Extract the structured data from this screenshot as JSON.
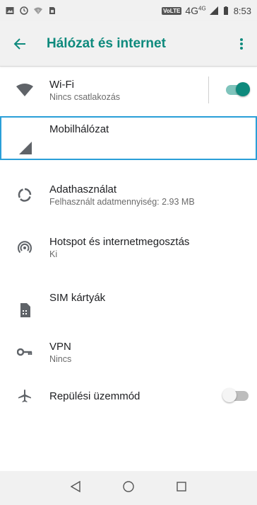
{
  "status_bar": {
    "volte": "VoLTE",
    "network": "4G",
    "network_sup": "4G",
    "time": "8:53"
  },
  "app_bar": {
    "title": "Hálózat és internet"
  },
  "items": [
    {
      "title": "Wi-Fi",
      "subtitle": "Nincs csatlakozás",
      "icon": "wifi-icon",
      "toggle_on": true
    },
    {
      "title": "Mobilhálózat",
      "icon": "signal-icon"
    },
    {
      "title": "Adathasználat",
      "subtitle": "Felhasznált adatmennyiség: 2.93 MB",
      "icon": "data-usage-icon"
    },
    {
      "title": "Hotspot és internetmegosztás",
      "subtitle": "Ki",
      "icon": "hotspot-icon"
    },
    {
      "title": "SIM kártyák",
      "icon": "sim-card-icon"
    },
    {
      "title": "VPN",
      "subtitle": "Nincs",
      "icon": "vpn-key-icon"
    },
    {
      "title": "Repülési üzemmód",
      "icon": "airplane-icon",
      "toggle_on": false
    }
  ],
  "colors": {
    "accent": "#0e8a7d",
    "focus_border": "#2a9fd8",
    "toggle_on_knob": "#0e8a7d",
    "toggle_on_track": "#7fc4bc",
    "toggle_off_knob": "#f5f5f5",
    "toggle_off_track": "#bdbdbd"
  }
}
